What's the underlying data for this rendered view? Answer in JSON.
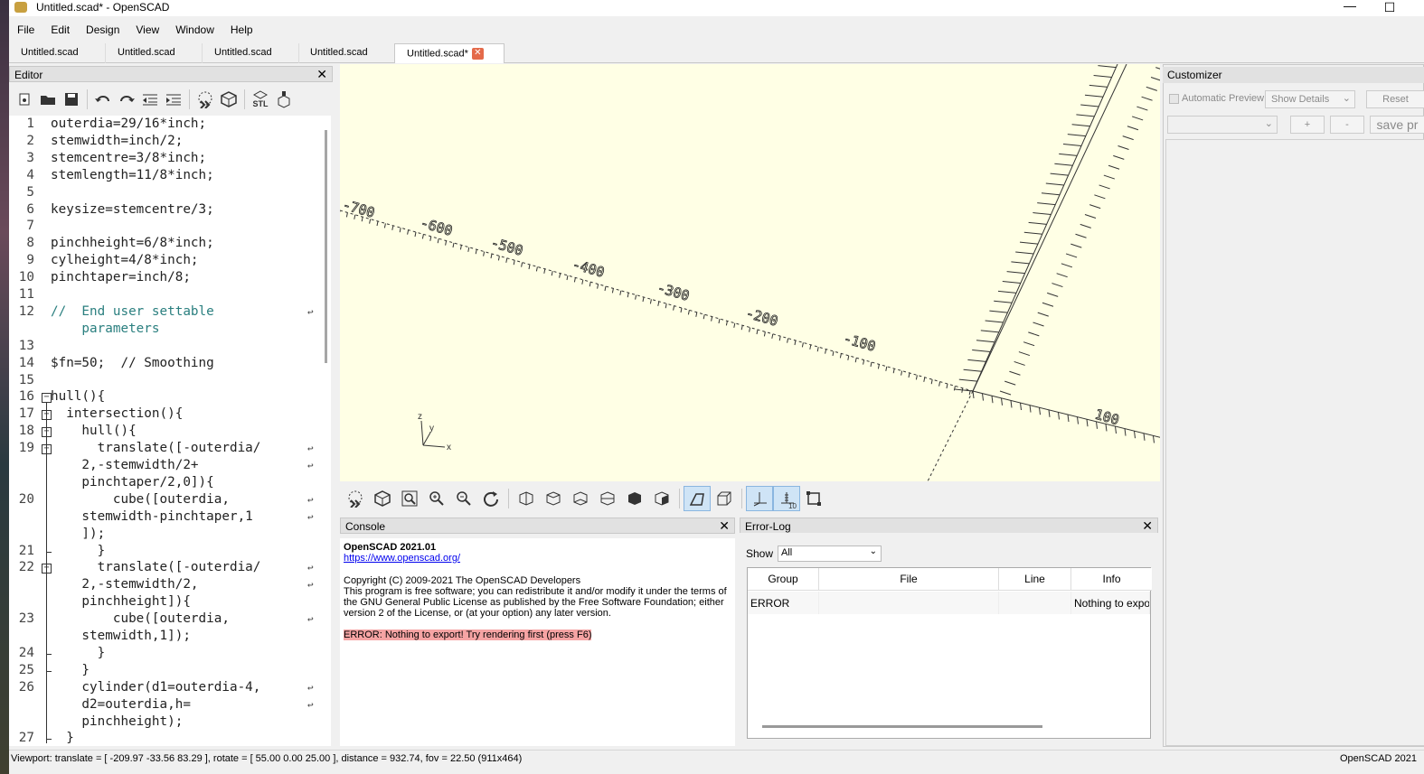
{
  "window": {
    "title": "Untitled.scad* - OpenSCAD",
    "minimize": "—",
    "maximize": "☐"
  },
  "menu": [
    "File",
    "Edit",
    "Design",
    "View",
    "Window",
    "Help"
  ],
  "tabs": [
    {
      "label": "Untitled.scad"
    },
    {
      "label": "Untitled.scad"
    },
    {
      "label": "Untitled.scad"
    },
    {
      "label": "Untitled.scad"
    },
    {
      "label": "Untitled.scad*",
      "active": true
    }
  ],
  "editor": {
    "title": "Editor",
    "close": "✕",
    "toolbar_icons": [
      "new-file-icon",
      "open-file-icon",
      "save-icon",
      "undo-icon",
      "redo-icon",
      "unindent-icon",
      "indent-icon",
      "preview-icon",
      "render-icon",
      "export-stl-icon",
      "send-to-print-icon"
    ],
    "stl_label": "STL",
    "lines": [
      {
        "n": "1",
        "text": "outerdia=29/16*inch;"
      },
      {
        "n": "2",
        "text": "stemwidth=inch/2;"
      },
      {
        "n": "3",
        "text": "stemcentre=3/8*inch;"
      },
      {
        "n": "4",
        "text": "stemlength=11/8*inch;"
      },
      {
        "n": "5",
        "text": ""
      },
      {
        "n": "6",
        "text": "keysize=stemcentre/3;"
      },
      {
        "n": "7",
        "text": ""
      },
      {
        "n": "8",
        "text": "pinchheight=6/8*inch;"
      },
      {
        "n": "9",
        "text": "cylheight=4/8*inch;"
      },
      {
        "n": "10",
        "text": "pinchtaper=inch/8;"
      },
      {
        "n": "11",
        "text": ""
      },
      {
        "n": "12",
        "text": "//  End user settable"
      },
      {
        "n": "",
        "text": "    parameters"
      },
      {
        "n": "13",
        "text": ""
      },
      {
        "n": "14",
        "text": "$fn=50;  // Smoothing"
      },
      {
        "n": "15",
        "text": ""
      },
      {
        "n": "16",
        "text": "hull(){"
      },
      {
        "n": "17",
        "text": "  intersection(){"
      },
      {
        "n": "18",
        "text": "    hull(){"
      },
      {
        "n": "19",
        "text": "      translate([-outerdia/"
      },
      {
        "n": "",
        "text": "    2,-stemwidth/2+"
      },
      {
        "n": "",
        "text": "    pinchtaper/2,0]){"
      },
      {
        "n": "20",
        "text": "        cube([outerdia,"
      },
      {
        "n": "",
        "text": "    stemwidth-pinchtaper,1"
      },
      {
        "n": "",
        "text": "    ]);"
      },
      {
        "n": "21",
        "text": "      }"
      },
      {
        "n": "22",
        "text": "      translate([-outerdia/"
      },
      {
        "n": "",
        "text": "    2,-stemwidth/2,"
      },
      {
        "n": "",
        "text": "    pinchheight]){"
      },
      {
        "n": "23",
        "text": "        cube([outerdia,"
      },
      {
        "n": "",
        "text": "    stemwidth,1]);"
      },
      {
        "n": "24",
        "text": "      }"
      },
      {
        "n": "25",
        "text": "    }"
      },
      {
        "n": "26",
        "text": "    cylinder(d1=outerdia-4,"
      },
      {
        "n": "",
        "text": "    d2=outerdia,h="
      },
      {
        "n": "",
        "text": "    pinchheight);"
      },
      {
        "n": "27",
        "text": "  }"
      }
    ]
  },
  "viewport": {
    "axis_labels": [
      "-700",
      "-600",
      "-500",
      "-400",
      "-300",
      "-200",
      "-100",
      "100"
    ],
    "gizmo": {
      "z": "z",
      "y": "y",
      "x": "x"
    },
    "toolbar_icons": [
      "preview-icon",
      "render-icon",
      "view-all-icon",
      "zoom-in-icon",
      "zoom-out-icon",
      "reset-view-icon",
      "view-right-icon",
      "view-top-icon",
      "view-bottom-icon",
      "view-left-icon",
      "view-front-icon",
      "view-back-icon",
      "perspective-icon",
      "orthogonal-icon",
      "show-axes-icon",
      "show-scale-markers-icon",
      "show-edges-icon"
    ],
    "scale_marker_label": "10"
  },
  "console": {
    "title": "Console",
    "close": "✕",
    "heading": "OpenSCAD 2021.01",
    "link": "https://www.openscad.org/",
    "copyright": "Copyright (C) 2009-2021 The OpenSCAD Developers",
    "license1": "This program is free software; you can redistribute it and/or modify it under the terms of",
    "license2": "the GNU General Public License as published by the Free Software Foundation; either",
    "license3": "version 2 of the License, or (at your option) any later version.",
    "error": "ERROR: Nothing to export! Try rendering first (press F6)"
  },
  "errorlog": {
    "title": "Error-Log",
    "close": "✕",
    "show_label": "Show",
    "show_value": "All",
    "columns": [
      "Group",
      "File",
      "Line",
      "Info"
    ],
    "rows": [
      {
        "group": "ERROR",
        "file": "",
        "line": "",
        "info": "Nothing to expo"
      }
    ]
  },
  "customizer": {
    "title": "Customizer",
    "automatic_preview": "Automatic Preview",
    "show_details": "Show Details",
    "reset": "Reset",
    "plus": "+",
    "minus": "-",
    "save": "save pr"
  },
  "status": {
    "viewport": "Viewport: translate = [ -209.97 -33.56 83.29 ], rotate = [ 55.00 0.00 25.00 ], distance = 932.74, fov = 22.50 (911x464)",
    "version": "OpenSCAD 2021"
  },
  "colors": {
    "viewport_bg": "#ffffe5",
    "error_bg": "#f6a4a4",
    "comment": "#2a7f7f"
  }
}
